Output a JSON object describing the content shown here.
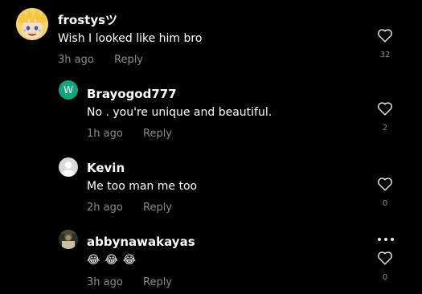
{
  "colors": {
    "background": "#000000",
    "text": "#ffffff",
    "secondary": "#8a8b91",
    "like_icon": "#e6e6e6",
    "w_avatar": "#13a37f",
    "default_avatar": "#d9d9d9"
  },
  "comments": [
    {
      "username": "frostysツ",
      "text": "Wish I looked like him bro",
      "time": "3h ago",
      "reply_label": "Reply",
      "likes": "32",
      "avatar_icon": "anime-character-avatar"
    },
    {
      "username": "Brayogod777",
      "text": "No . you're unique and beautiful.",
      "time": "1h ago",
      "reply_label": "Reply",
      "likes": "2",
      "avatar_letter": "W",
      "avatar_icon": "letter-avatar"
    },
    {
      "username": "Kevin",
      "text": "Me too man me too",
      "time": "2h ago",
      "reply_label": "Reply",
      "likes": "0",
      "avatar_icon": "default-person-avatar"
    },
    {
      "username": "abbynawakayas",
      "emojis": [
        "😂",
        "😂",
        "😂"
      ],
      "time": "3h ago",
      "reply_label": "Reply",
      "likes": "0",
      "avatar_icon": "photo-avatar",
      "more_icon": "more-options-icon"
    }
  ]
}
